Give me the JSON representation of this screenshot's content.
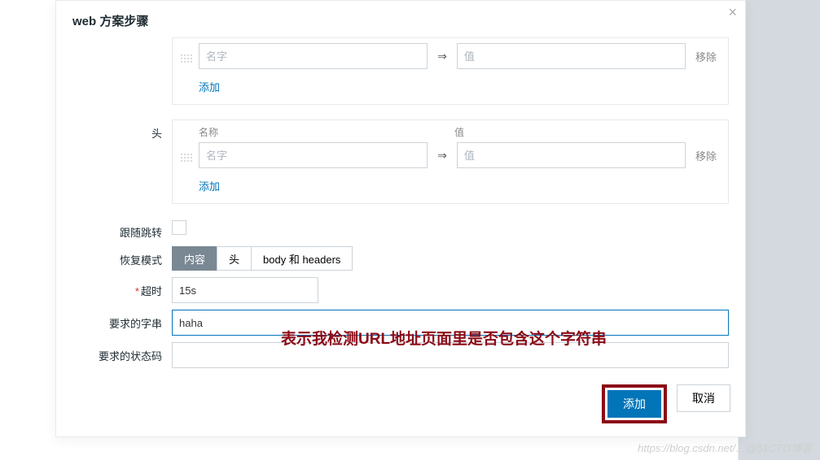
{
  "modal": {
    "title": "web 方案步骤",
    "close_icon": "×"
  },
  "vars_section": {
    "name_placeholder": "名字",
    "value_placeholder": "值",
    "remove_label": "移除",
    "add_label": "添加",
    "arrow": "⇒"
  },
  "headers_section": {
    "label": "头",
    "col_name": "名称",
    "col_value": "值",
    "name_placeholder": "名字",
    "value_placeholder": "值",
    "remove_label": "移除",
    "add_label": "添加",
    "arrow": "⇒"
  },
  "follow_redirects": {
    "label": "跟随跳转",
    "checked": false
  },
  "retrieve_mode": {
    "label": "恢复模式",
    "options": [
      "内容",
      "头",
      "body 和 headers"
    ],
    "active_index": 0
  },
  "timeout": {
    "label": "超时",
    "value": "15s",
    "required": true
  },
  "required_string": {
    "label": "要求的字串",
    "value": "haha"
  },
  "status_codes": {
    "label": "要求的状态码",
    "value": ""
  },
  "footer": {
    "submit": "添加",
    "cancel": "取消"
  },
  "annotation_text": "表示我检测URL地址页面里是否包含这个字符串",
  "watermark": "https://blog.csdn.net/…@51CTO博客"
}
